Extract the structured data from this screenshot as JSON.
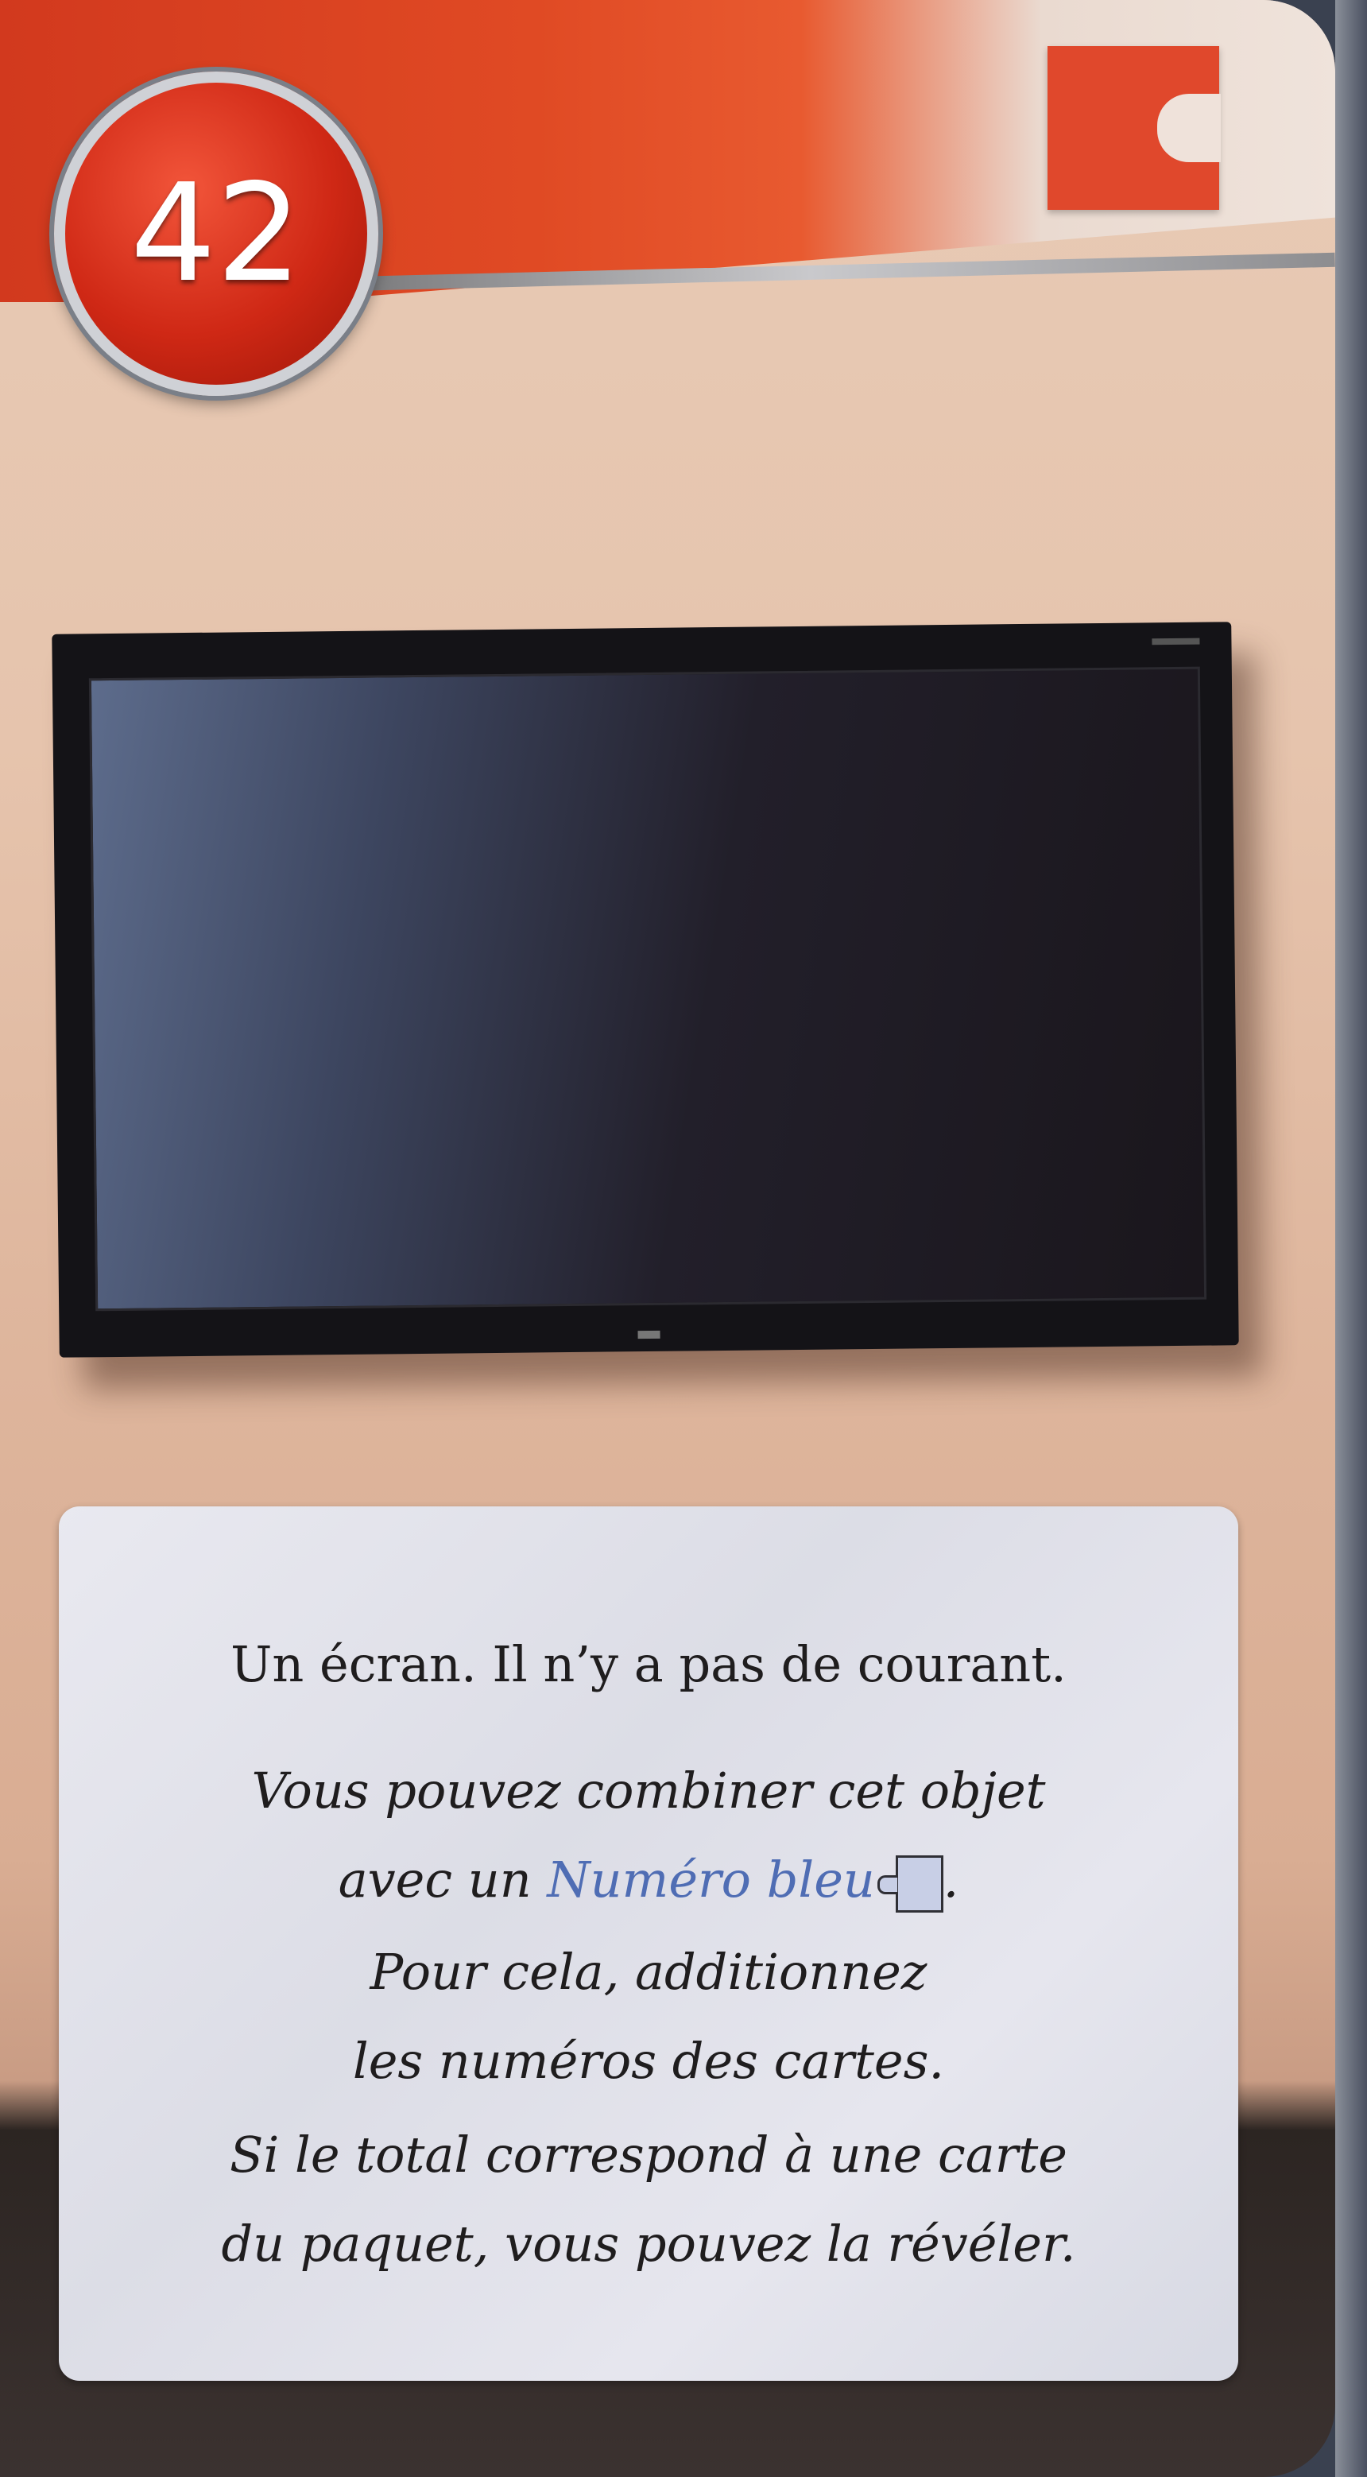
{
  "card": {
    "number": "42",
    "type_icon": "red-puzzle-piece-icon",
    "description": "Un écran. Il n’y a pas de courant.",
    "combine_line1": "Vous pouvez combiner cet objet",
    "combine_line2_prefix": "avec un ",
    "combine_highlight": "Numéro bleu",
    "combine_line2_suffix": ".",
    "instruction_line1": "Pour cela, additionnez",
    "instruction_line2": "les numéros des cartes.",
    "reveal_line1": "Si le total correspond à une carte",
    "reveal_line2": "du paquet, vous pouvez la révéler.",
    "highlight_color": "#4f6db4",
    "accent_color": "#e0482c"
  }
}
